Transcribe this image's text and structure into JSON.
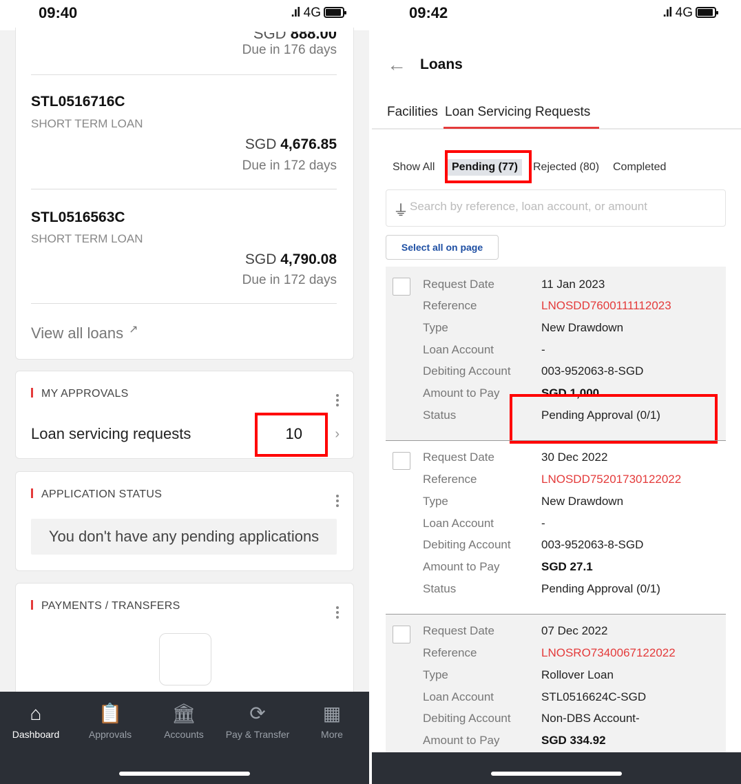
{
  "left_screen": {
    "status_bar": {
      "time": "09:40",
      "network": "4G"
    },
    "partial_amount_prefix": "SGD",
    "partial_amount_value": "888.00",
    "partial_due": "Due in 176 days",
    "loans": [
      {
        "id": "STL0516716C",
        "type": "SHORT TERM LOAN",
        "currency": "SGD",
        "amount": "4,676.85",
        "due": "Due in 172 days"
      },
      {
        "id": "STL0516563C",
        "type": "SHORT TERM LOAN",
        "currency": "SGD",
        "amount": "4,790.08",
        "due": "Due in 172 days"
      }
    ],
    "view_all_label": "View all loans",
    "my_approvals": {
      "title": "MY APPROVALS",
      "item_label": "Loan servicing requests",
      "item_count": "10"
    },
    "application_status": {
      "title": "APPLICATION STATUS",
      "empty_message": "You don't have any pending applications"
    },
    "payments_transfers": {
      "title": "PAYMENTS / TRANSFERS"
    },
    "bottom_nav": [
      {
        "label": "Dashboard",
        "icon": "home-icon"
      },
      {
        "label": "Approvals",
        "icon": "clipboard-check-icon"
      },
      {
        "label": "Accounts",
        "icon": "bank-icon"
      },
      {
        "label": "Pay & Transfer",
        "icon": "transfer-icon"
      },
      {
        "label": "More",
        "icon": "grid-icon"
      }
    ],
    "highlight_color": "#ff0000"
  },
  "right_screen": {
    "status_bar": {
      "time": "09:42",
      "network": "4G"
    },
    "header_title": "Loans",
    "tabs": [
      {
        "label": "Facilities"
      },
      {
        "label": "Loan Servicing Requests"
      }
    ],
    "filters": [
      {
        "label": "Show All"
      },
      {
        "label": "Pending (77)"
      },
      {
        "label": "Rejected (80)"
      },
      {
        "label": "Completed"
      }
    ],
    "search_placeholder": "Search by reference, loan account, or amount",
    "select_all_label": "Select all on page",
    "field_labels": {
      "request_date": "Request Date",
      "reference": "Reference",
      "type": "Type",
      "loan_account": "Loan Account",
      "debiting_account": "Debiting Account",
      "amount_to_pay": "Amount to Pay",
      "status": "Status"
    },
    "requests": [
      {
        "request_date": "11 Jan 2023",
        "reference": "LNOSDD7600111112023",
        "type": "New Drawdown",
        "loan_account": "-",
        "debiting_account": "003-952063-8-SGD",
        "amount_to_pay": "SGD 1,000",
        "status": "Pending Approval (0/1)"
      },
      {
        "request_date": "30 Dec 2022",
        "reference": "LNOSDD75201730122022",
        "type": "New Drawdown",
        "loan_account": "-",
        "debiting_account": "003-952063-8-SGD",
        "amount_to_pay": "SGD 27.1",
        "status": "Pending Approval (0/1)"
      },
      {
        "request_date": "07 Dec 2022",
        "reference": "LNOSRO7340067122022",
        "type": "Rollover Loan",
        "loan_account": "STL0516624C-SGD",
        "debiting_account": "Non-DBS Account-",
        "amount_to_pay": "SGD 334.92"
      }
    ],
    "accent_color": "#e43b3b",
    "link_color": "#1e4fa3"
  }
}
